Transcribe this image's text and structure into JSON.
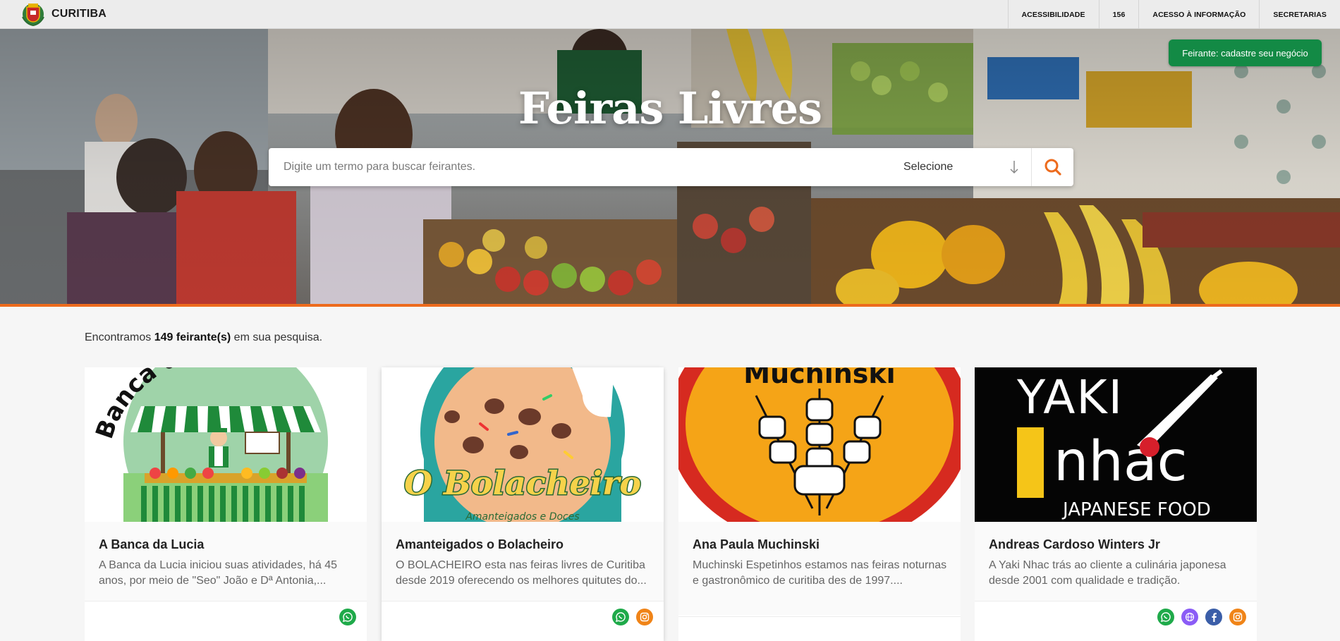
{
  "header": {
    "brand": "CURITIBA",
    "nav": [
      {
        "label": "ACESSIBILIDADE"
      },
      {
        "label": "156"
      },
      {
        "label": "ACESSO À INFORMAÇÃO"
      },
      {
        "label": "SECRETARIAS"
      }
    ]
  },
  "hero": {
    "title": "Feiras Livres",
    "cta_label": "Feirante: cadastre seu negócio",
    "search": {
      "placeholder": "Digite um termo para buscar feirantes.",
      "select_label": "Selecione"
    }
  },
  "results": {
    "prefix": "Encontramos ",
    "count": "149 feirante(s)",
    "suffix": " em sua pesquisa."
  },
  "cards": [
    {
      "title": "A Banca da Lucia",
      "description": "A Banca da Lucia iniciou suas atividades, há 45 anos, por meio de \"Seo\" João e Dª Antonia,...",
      "image_text": "Banca da Lucia",
      "icons": [
        "whatsapp-icon"
      ]
    },
    {
      "title": "Amanteigados o Bolacheiro",
      "description": "O BOLACHEIRO esta nas feiras livres de Curitiba desde 2019 oferecendo os melhores quitutes do...",
      "image_text": "O Bolacheiro",
      "image_subtext": "Amanteigados e Doces",
      "icons": [
        "whatsapp-icon",
        "instagram-icon"
      ]
    },
    {
      "title": "Ana Paula Muchinski",
      "description": "Muchinski Espetinhos estamos nas feiras noturnas e gastronômico de curitiba des de 1997....",
      "image_text": "Muchinski",
      "icons": []
    },
    {
      "title": "Andreas Cardoso Winters Jr",
      "description": "A Yaki Nhac trás ao cliente a culinária japonesa desde 2001 com qualidade e tradição.",
      "image_text_top": "YAKI",
      "image_text_mid": "nhac",
      "image_text_bottom": "JAPANESE FOOD",
      "icons": [
        "whatsapp-icon",
        "website-icon",
        "facebook-icon",
        "instagram-icon"
      ]
    }
  ],
  "colors": {
    "accent": "#ed6b1d",
    "cta": "#138a45",
    "whatsapp": "#1faa4a",
    "instagram": "#f08418"
  }
}
